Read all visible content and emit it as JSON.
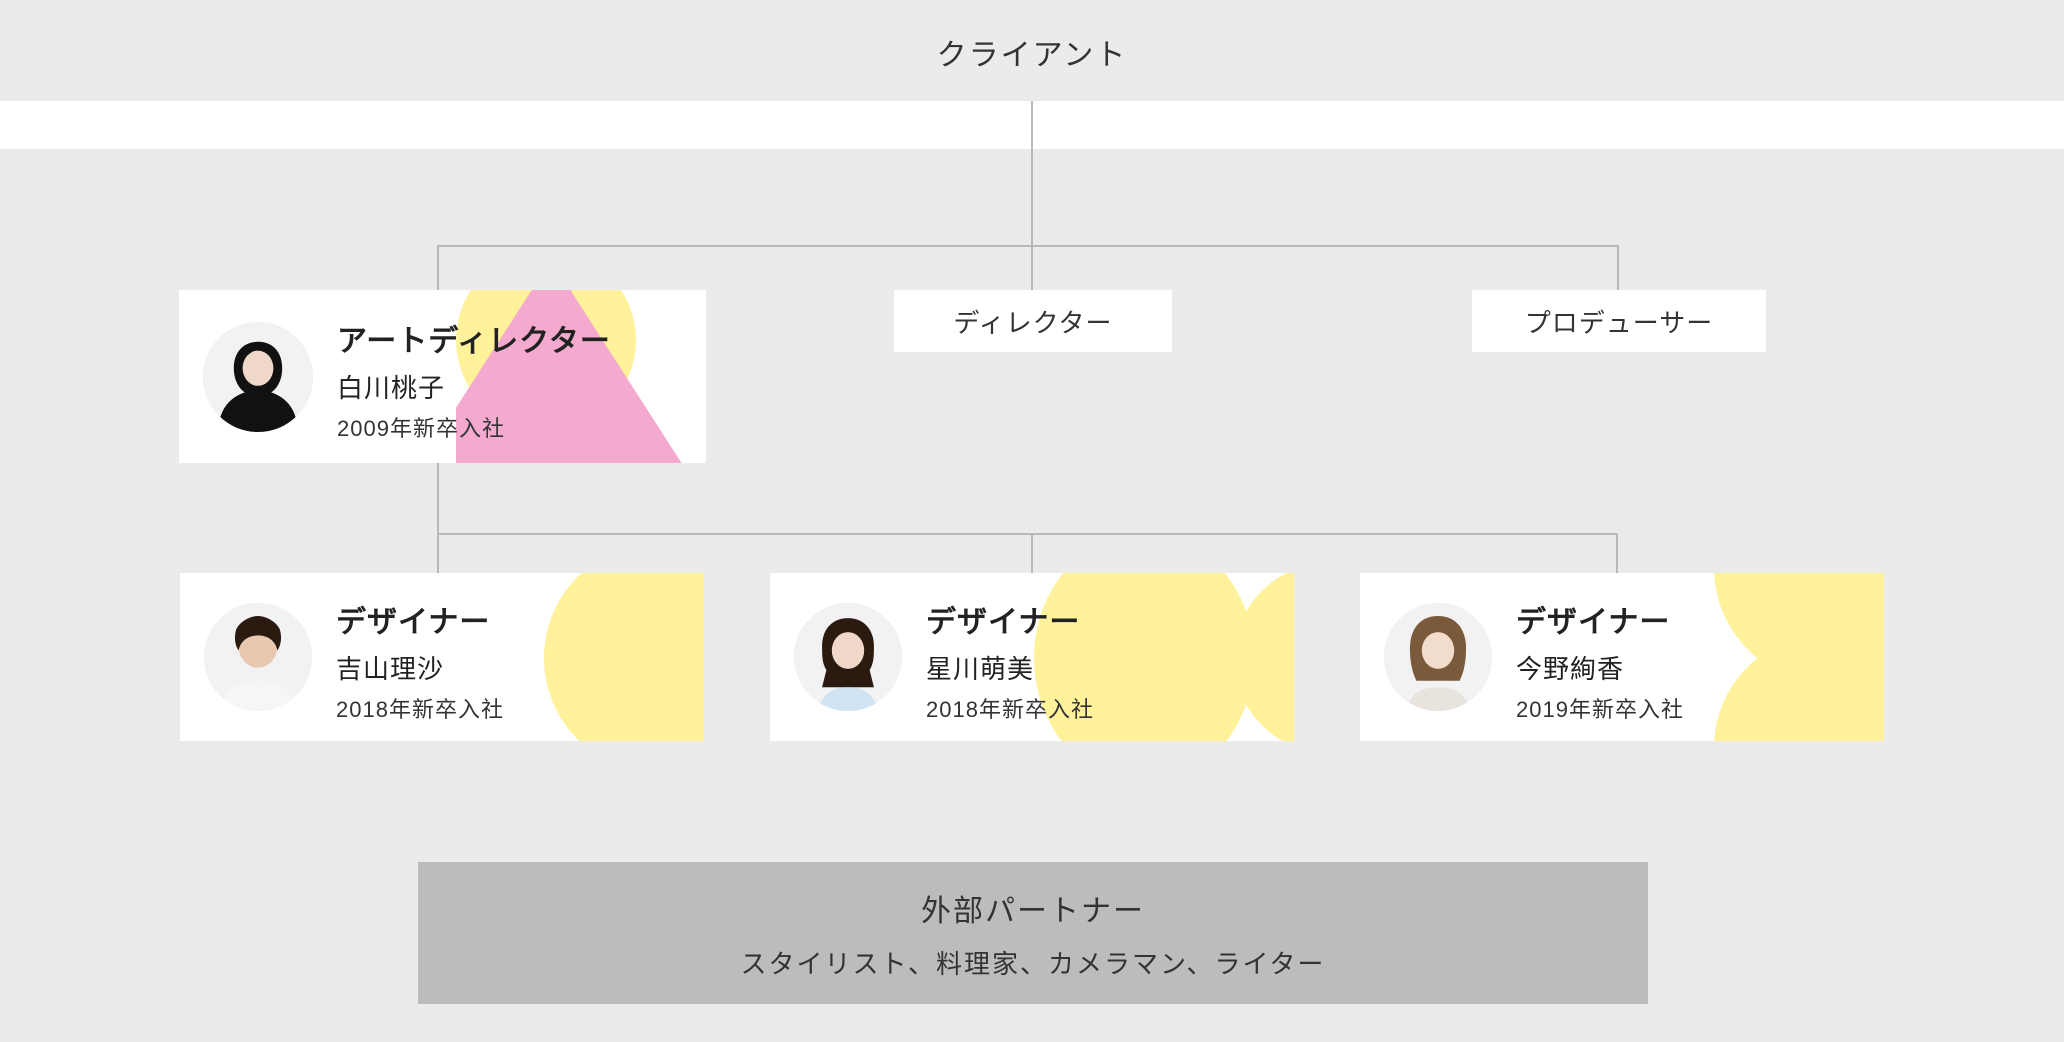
{
  "client_label": "クライアント",
  "row1": {
    "art_director": {
      "role": "アートディレクター",
      "name": "白川桃子",
      "year": "2009年新卒入社"
    },
    "director_label": "ディレクター",
    "producer_label": "プロデューサー"
  },
  "designers": [
    {
      "role": "デザイナー",
      "name": "吉山理沙",
      "year": "2018年新卒入社"
    },
    {
      "role": "デザイナー",
      "name": "星川萌美",
      "year": "2018年新卒入社"
    },
    {
      "role": "デザイナー",
      "name": "今野絢香",
      "year": "2019年新卒入社"
    }
  ],
  "partner": {
    "title": "外部パートナー",
    "subtitle": "スタイリスト、料理家、カメラマン、ライター"
  },
  "colors": {
    "bg": "#ebebeb",
    "line": "#b9b9b9",
    "yellow": "#fff29a",
    "pink": "#f4a9cf",
    "partner_bg": "#bcbcbc"
  }
}
